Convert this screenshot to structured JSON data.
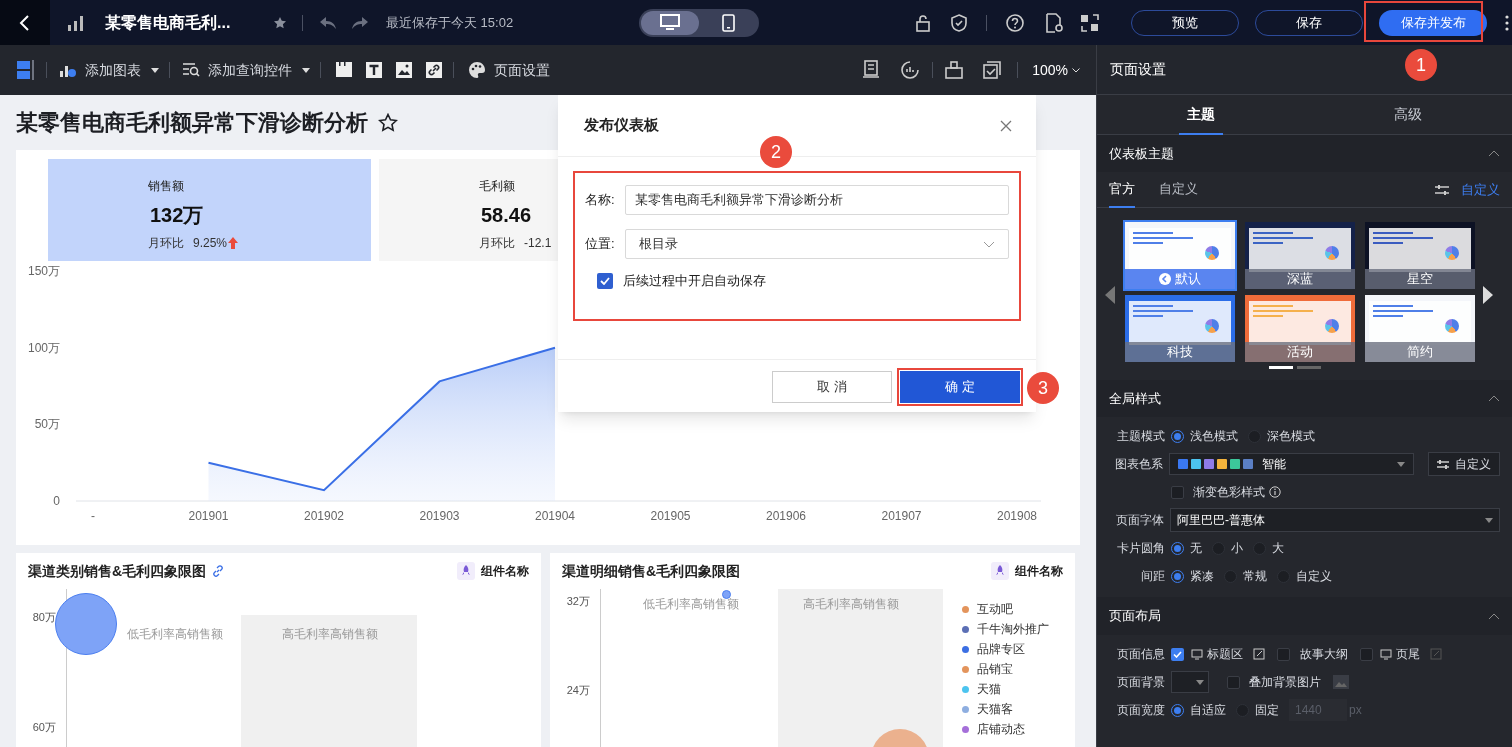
{
  "top_bar": {
    "title": "某零售电商毛利...",
    "saved_time": "最近保存于今天 15:02",
    "devices": [
      {
        "kind": "desktop",
        "selected": true
      },
      {
        "kind": "mobile",
        "selected": false
      }
    ],
    "buttons": [
      {
        "label": "预览",
        "primary": false
      },
      {
        "label": "保存",
        "primary": false
      },
      {
        "label": "保存并发布",
        "primary": true
      }
    ]
  },
  "toolbar": {
    "items": [
      {
        "kind": "chart",
        "label": "添加图表",
        "dropdown": true
      },
      {
        "kind": "query",
        "label": "添加查询控件",
        "dropdown": true
      },
      {
        "kind": "tab"
      },
      {
        "kind": "text"
      },
      {
        "kind": "image"
      },
      {
        "kind": "link"
      },
      {
        "kind": "palette",
        "label": "页面设置",
        "dropdown": false
      }
    ],
    "zoom": "100%"
  },
  "dashboard": {
    "title": "某零售电商毛利额异常下滑诊断分析",
    "kpis": [
      {
        "label": "销售额",
        "value": "132万",
        "change_label": "月环比",
        "change": "9.25%",
        "trend_up": true,
        "selected": true
      },
      {
        "label": "毛利额",
        "value": "58.46",
        "change_label": "月环比",
        "change": "-12.1",
        "selected": false
      }
    ],
    "chart_data": {
      "type": "area",
      "categories": [
        "-",
        "201901",
        "201902",
        "201903",
        "201904",
        "201905",
        "201906",
        "201907",
        "201908"
      ],
      "series": [
        {
          "color": "#3a6fe6",
          "values": [
            null,
            25,
            7,
            78,
            100,
            null,
            null,
            null,
            null
          ]
        }
      ],
      "ylim": [
        0,
        150
      ],
      "yticks": [
        {
          "value": 0,
          "label": "0"
        },
        {
          "value": 50,
          "label": "50万"
        },
        {
          "value": 100,
          "label": "100万"
        },
        {
          "value": 150,
          "label": "150万"
        }
      ]
    },
    "quadrant_charts": [
      {
        "title": "渠道类别销售&毛利四象限图",
        "linked": true,
        "component_label": "组件名称",
        "y_ticks": [
          "80万",
          "60万"
        ],
        "quadrant_labels": [
          "低毛利率高销售额",
          "高毛利率高销售额"
        ]
      },
      {
        "title": "渠道明细销售&毛利四象限图",
        "component_label": "组件名称",
        "y_ticks": [
          "32万",
          "24万"
        ],
        "quadrant_labels": [
          "低毛利率高销售额",
          "高毛利率高销售额"
        ],
        "legend": [
          {
            "label": "互动吧",
            "color": "#e3945c"
          },
          {
            "label": "千牛淘外推广",
            "color": "#5b6fb5"
          },
          {
            "label": "品牌专区",
            "color": "#3b6fe3"
          },
          {
            "label": "品销宝",
            "color": "#e3945c"
          },
          {
            "label": "天猫",
            "color": "#4cc4ef"
          },
          {
            "label": "天猫客",
            "color": "#8eaee0"
          },
          {
            "label": "店铺动态",
            "color": "#a56fd9"
          }
        ]
      }
    ]
  },
  "dialog": {
    "title": "发布仪表板",
    "fields": [
      {
        "kind": "text",
        "label": "名称:",
        "value": "某零售电商毛利额异常下滑诊断分析"
      },
      {
        "kind": "select",
        "label": "位置:",
        "value": "根目录"
      }
    ],
    "autosave": {
      "label": "后续过程中开启自动保存",
      "checked": true
    },
    "buttons": [
      {
        "label": "取 消",
        "primary": false
      },
      {
        "label": "确 定",
        "primary": true
      }
    ]
  },
  "annotations": [
    {
      "number": "1"
    },
    {
      "number": "2"
    },
    {
      "number": "3"
    }
  ],
  "settings_panel": {
    "title": "页面设置",
    "tabs": [
      {
        "label": "主题",
        "selected": true
      },
      {
        "label": "高级",
        "selected": false
      }
    ],
    "theme_section": {
      "title": "仪表板主题",
      "expanded": true,
      "subtabs": [
        {
          "label": "官方",
          "selected": true
        },
        {
          "label": "自定义",
          "selected": false
        }
      ],
      "customize_link": "自定义",
      "themes": [
        {
          "name": "默认",
          "selected": true
        },
        {
          "name": "深蓝",
          "selected": false
        },
        {
          "name": "星空",
          "selected": false
        },
        {
          "name": "科技",
          "selected": false
        },
        {
          "name": "活动",
          "selected": false
        },
        {
          "name": "简约",
          "selected": false
        }
      ],
      "pages": [
        {
          "selected": true
        },
        {
          "selected": false
        }
      ]
    },
    "global_style": {
      "title": "全局样式",
      "expanded": true,
      "rows": [
        {
          "kind": "radio",
          "label": "主题模式",
          "options": [
            {
              "label": "浅色模式",
              "selected": true
            },
            {
              "label": "深色模式",
              "selected": false
            }
          ]
        },
        {
          "kind": "palette",
          "label": "图表色系",
          "colors": [
            {
              "color": "#3a78f2"
            },
            {
              "color": "#4cc4ef"
            },
            {
              "color": "#8f7ce8"
            },
            {
              "color": "#f5b43c"
            },
            {
              "color": "#3cc79a"
            },
            {
              "color": "#5b7fc4"
            }
          ],
          "value": "智能",
          "button": "自定义"
        },
        {
          "kind": "checkbox",
          "option": "渐变色彩样式",
          "checked": false
        },
        {
          "kind": "select",
          "label": "页面字体",
          "value": "阿里巴巴-普惠体"
        },
        {
          "kind": "radio",
          "label": "卡片圆角",
          "options": [
            {
              "label": "无",
              "selected": true
            },
            {
              "label": "小",
              "selected": false
            },
            {
              "label": "大",
              "selected": false
            }
          ]
        },
        {
          "kind": "radio",
          "label": "间距",
          "options": [
            {
              "label": "紧凑",
              "selected": true
            },
            {
              "label": "常规",
              "selected": false
            },
            {
              "label": "自定义",
              "selected": false
            }
          ]
        }
      ]
    },
    "page_layout": {
      "title": "页面布局",
      "expanded": true,
      "rows": [
        {
          "kind": "checks",
          "label": "页面信息",
          "options": [
            {
              "label": "标题区",
              "checked": true,
              "icons": true
            },
            {
              "label": "故事大纲",
              "checked": false
            },
            {
              "label": "页尾",
              "checked": false,
              "icons": true
            }
          ]
        },
        {
          "kind": "background",
          "label": "页面背景",
          "option": "叠加背景图片",
          "checked": false
        },
        {
          "kind": "width",
          "label": "页面宽度",
          "options": [
            {
              "label": "自适应",
              "selected": true
            },
            {
              "label": "固定",
              "selected": false
            }
          ],
          "width_value": "1440",
          "unit": "px"
        }
      ]
    }
  }
}
